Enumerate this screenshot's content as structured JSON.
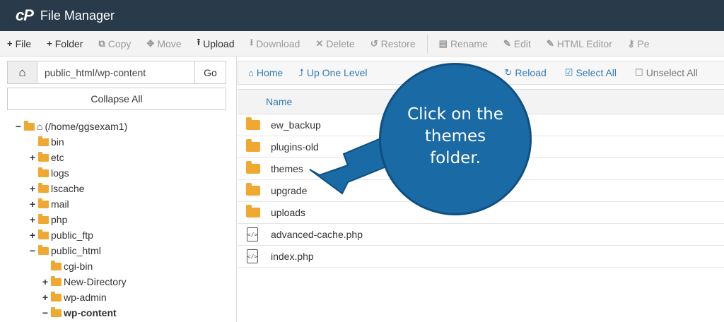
{
  "app": {
    "logo": "cP",
    "title": "File Manager"
  },
  "toolbar": {
    "items": [
      {
        "label": "File",
        "icon": "plus-icon",
        "glyph": "+",
        "enabled": true
      },
      {
        "label": "Folder",
        "icon": "plus-icon",
        "glyph": "+",
        "enabled": true
      },
      {
        "label": "Copy",
        "icon": "copy-icon",
        "glyph": "⧉",
        "enabled": false
      },
      {
        "label": "Move",
        "icon": "move-icon",
        "glyph": "✥",
        "enabled": false
      },
      {
        "label": "Upload",
        "icon": "upload-icon",
        "glyph": "⭱",
        "enabled": true
      },
      {
        "label": "Download",
        "icon": "download-icon",
        "glyph": "⭳",
        "enabled": false
      },
      {
        "label": "Delete",
        "icon": "delete-icon",
        "glyph": "✕",
        "enabled": false
      },
      {
        "label": "Restore",
        "icon": "restore-icon",
        "glyph": "↺",
        "enabled": false
      },
      {
        "label": "Rename",
        "icon": "rename-icon",
        "glyph": "▤",
        "enabled": false
      },
      {
        "label": "Edit",
        "icon": "edit-icon",
        "glyph": "✎",
        "enabled": false
      },
      {
        "label": "HTML Editor",
        "icon": "html-editor-icon",
        "glyph": "✎",
        "enabled": false
      },
      {
        "label": "Pe",
        "icon": "permissions-icon",
        "glyph": "⚷",
        "enabled": false
      }
    ]
  },
  "left": {
    "path_value": "public_html/wp-content",
    "go_label": "Go",
    "collapse_label": "Collapse All",
    "tree": [
      {
        "label": "(/home/ggsexam1)",
        "toggle": "−",
        "type": "home",
        "level": 0
      },
      {
        "label": "bin",
        "toggle": "",
        "type": "folder",
        "level": 1
      },
      {
        "label": "etc",
        "toggle": "+",
        "type": "folder",
        "level": 1
      },
      {
        "label": "logs",
        "toggle": "",
        "type": "folder",
        "level": 1
      },
      {
        "label": "lscache",
        "toggle": "+",
        "type": "folder",
        "level": 1
      },
      {
        "label": "mail",
        "toggle": "+",
        "type": "folder",
        "level": 1
      },
      {
        "label": "php",
        "toggle": "+",
        "type": "folder",
        "level": 1
      },
      {
        "label": "public_ftp",
        "toggle": "+",
        "type": "folder",
        "level": 1
      },
      {
        "label": "public_html",
        "toggle": "−",
        "type": "folder",
        "level": 1
      },
      {
        "label": "cgi-bin",
        "toggle": "",
        "type": "folder",
        "level": 2
      },
      {
        "label": "New-Directory",
        "toggle": "+",
        "type": "folder",
        "level": 2
      },
      {
        "label": "wp-admin",
        "toggle": "+",
        "type": "folder",
        "level": 2
      },
      {
        "label": "wp-content",
        "toggle": "−",
        "type": "folder",
        "level": 2,
        "bold": true
      }
    ]
  },
  "navbar": {
    "home": "Home",
    "up_one_level": "Up One Level",
    "reload": "Reload",
    "select_all": "Select All",
    "unselect_all": "Unselect All"
  },
  "table": {
    "name_header": "Name",
    "rows": [
      {
        "name": "ew_backup",
        "type": "folder"
      },
      {
        "name": "plugins-old",
        "type": "folder"
      },
      {
        "name": "themes",
        "type": "folder"
      },
      {
        "name": "upgrade",
        "type": "folder"
      },
      {
        "name": "uploads",
        "type": "folder"
      },
      {
        "name": "advanced-cache.php",
        "type": "file"
      },
      {
        "name": "index.php",
        "type": "file"
      }
    ]
  },
  "callout": {
    "text": "Click on the themes folder."
  },
  "colors": {
    "titlebar": "#293a4a",
    "link": "#3479b7",
    "folder": "#f0a830",
    "callout": "#1a6aa5"
  }
}
